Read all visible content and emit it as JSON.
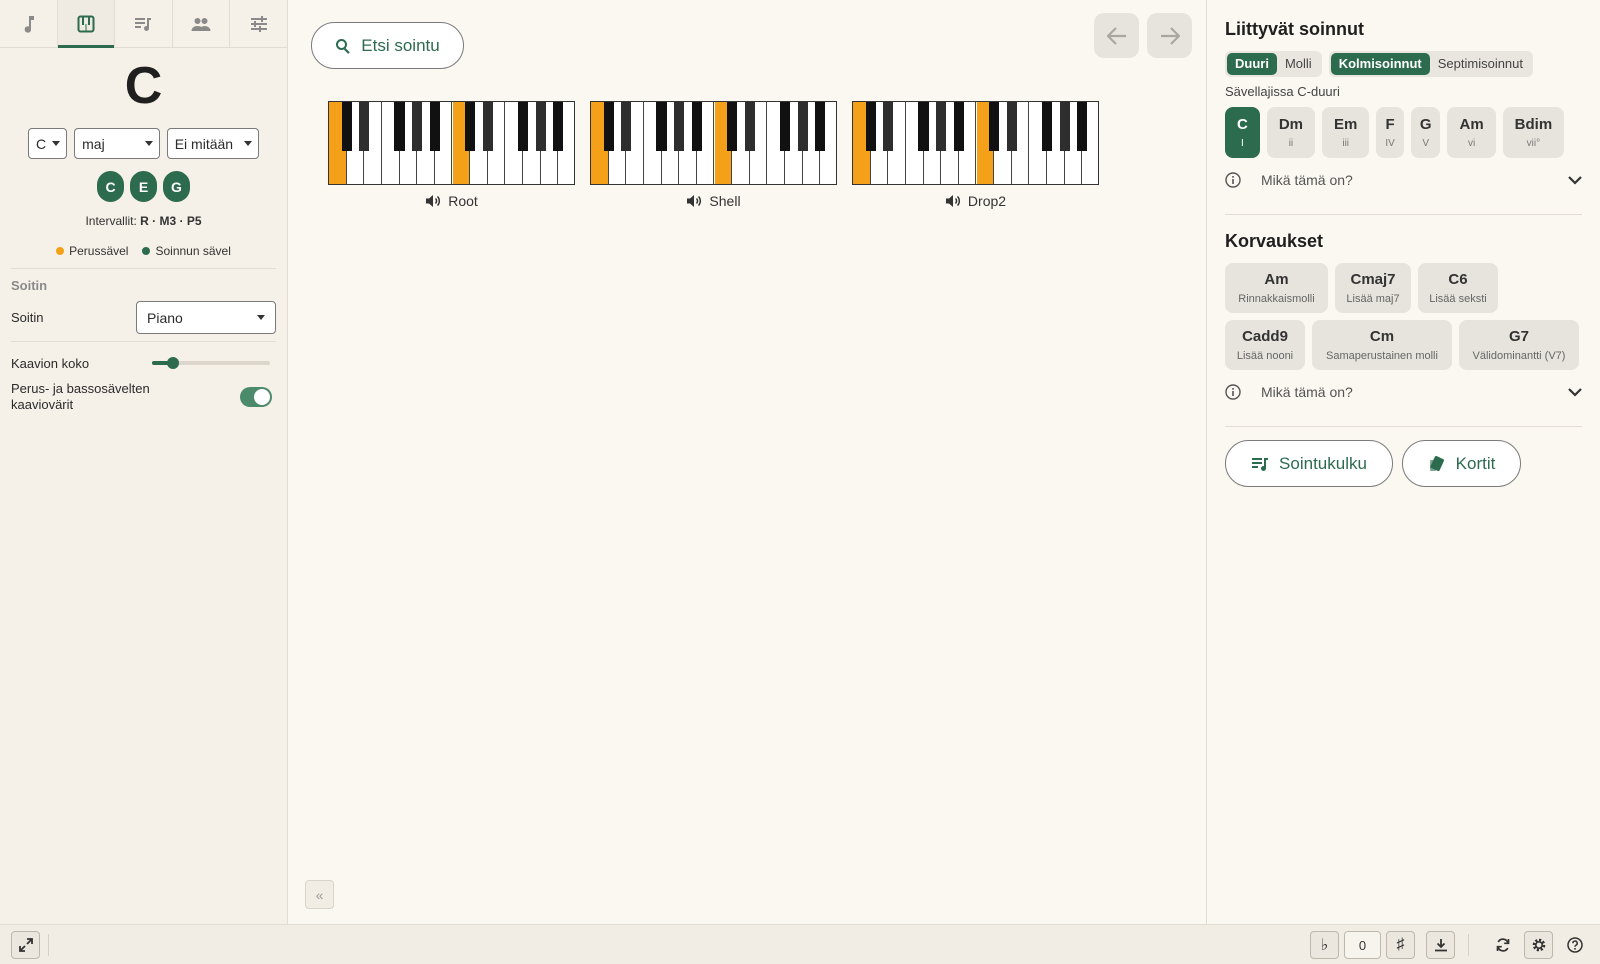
{
  "left": {
    "tabs": [
      "note-icon",
      "piano-icon",
      "queue-music-icon",
      "people-icon",
      "tune-icon"
    ],
    "chord_name": "C",
    "root_select": "C",
    "quality_select": "maj",
    "extension_select": "Ei mitään",
    "notes": [
      "C",
      "E",
      "G"
    ],
    "intervals_label": "Intervallit:",
    "intervals_value": "R · M3 · P5",
    "legend_root": "Perussävel",
    "legend_chord": "Soinnun sävel",
    "section_instrument": "Soitin",
    "instrument_label": "Soitin",
    "instrument_value": "Piano",
    "diagram_size_label": "Kaavion koko",
    "diagram_size_value": 0.18,
    "color_toggle_label": "Perus- ja bassosävelten kaaviovärit",
    "color_toggle_on": true
  },
  "center": {
    "search_label": "Etsi sointu",
    "voicings": [
      {
        "label": "Root",
        "root_keys": [
          0,
          7
        ]
      },
      {
        "label": "Shell",
        "root_keys": [
          0,
          7
        ]
      },
      {
        "label": "Drop2",
        "root_keys": [
          0,
          7
        ]
      }
    ]
  },
  "right": {
    "related_title": "Liittyvät soinnut",
    "mode_options": [
      "Duuri",
      "Molli"
    ],
    "mode_selected": "Duuri",
    "type_options": [
      "Kolmisoinnut",
      "Septimisoinnut"
    ],
    "type_selected": "Kolmisoinnut",
    "key_label": "Sävellajissa C-duuri",
    "chords": [
      {
        "name": "C",
        "roman": "I",
        "selected": true
      },
      {
        "name": "Dm",
        "roman": "ii"
      },
      {
        "name": "Em",
        "roman": "iii"
      },
      {
        "name": "F",
        "roman": "IV"
      },
      {
        "name": "G",
        "roman": "V"
      },
      {
        "name": "Am",
        "roman": "vi"
      },
      {
        "name": "Bdim",
        "roman": "vii°"
      }
    ],
    "info_label": "Mikä tämä on?",
    "subs_title": "Korvaukset",
    "substitutions": [
      {
        "name": "Am",
        "desc": "Rinnakkaismolli"
      },
      {
        "name": "Cmaj7",
        "desc": "Lisää maj7"
      },
      {
        "name": "C6",
        "desc": "Lisää seksti"
      },
      {
        "name": "Cadd9",
        "desc": "Lisää nooni"
      },
      {
        "name": "Cm",
        "desc": "Samaperustainen molli"
      },
      {
        "name": "G7",
        "desc": "Välidominantti (V7)"
      }
    ],
    "progression_label": "Sointukulku",
    "cards_label": "Kortit"
  },
  "bottom": {
    "transpose_value": "0",
    "flat_symbol": "♭",
    "sharp_symbol": "♯"
  },
  "colors": {
    "accent": "#2d6b4f",
    "root": "#f5a019"
  }
}
